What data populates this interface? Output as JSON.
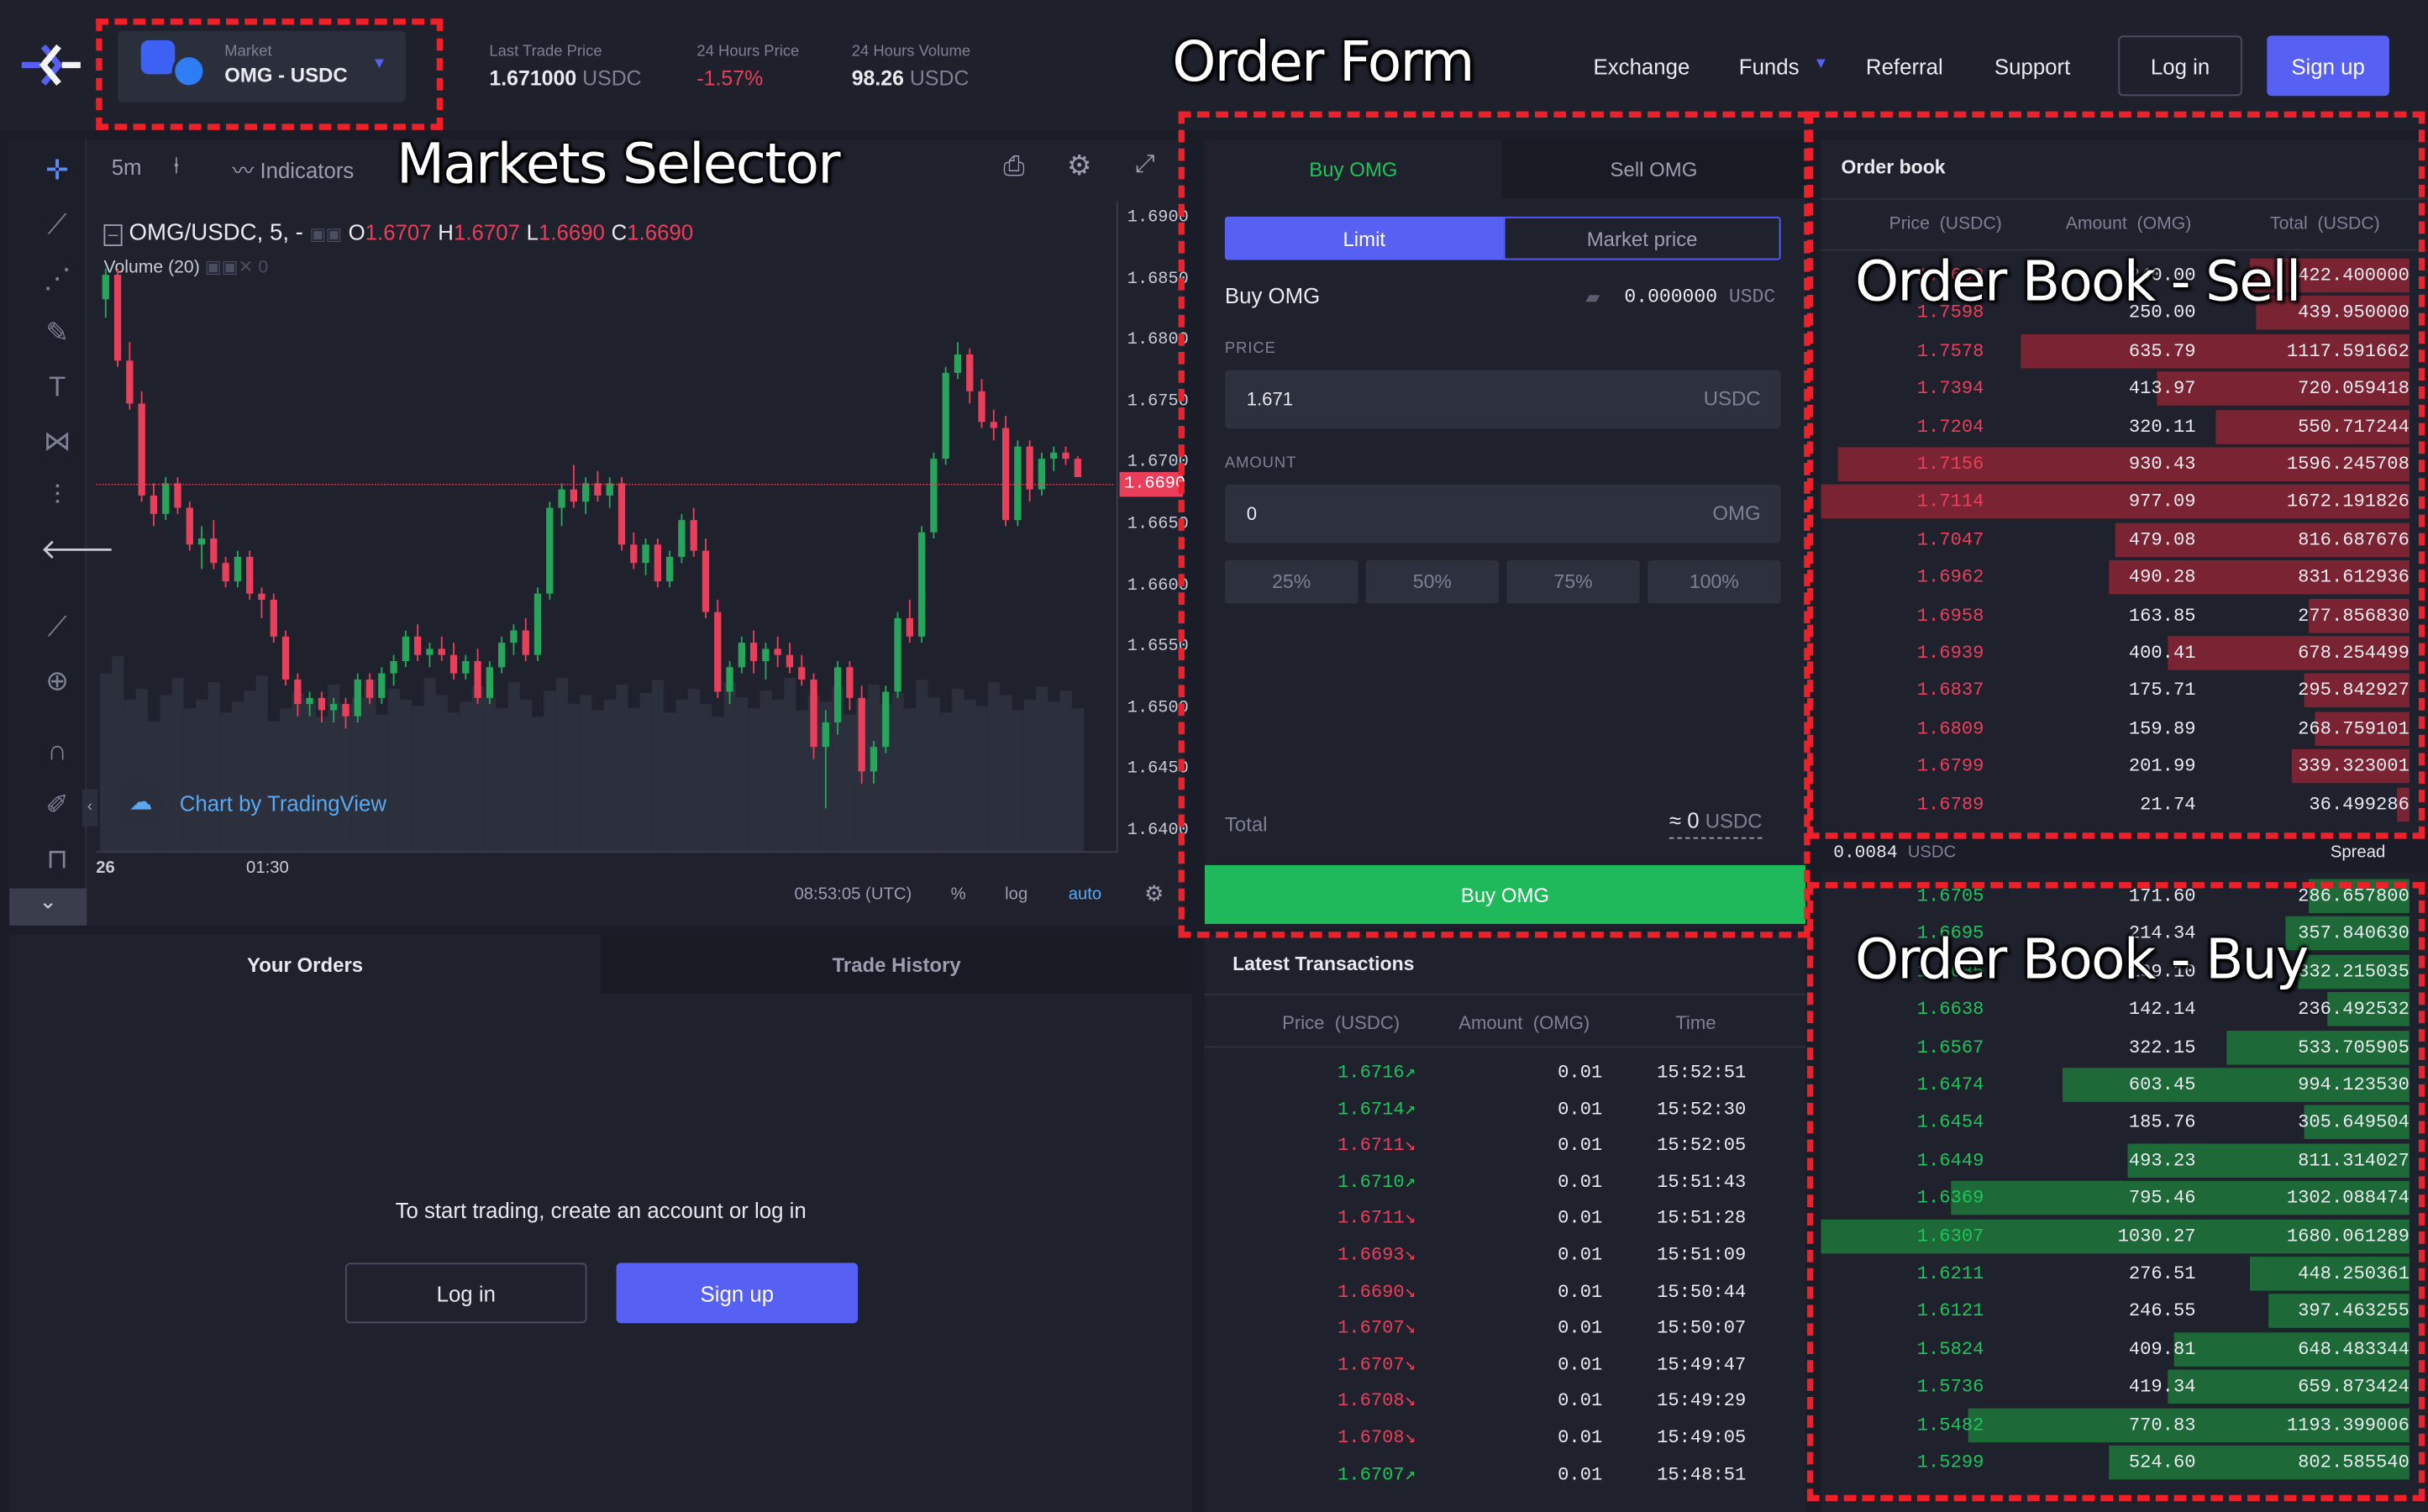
{
  "header": {
    "market_label": "Market",
    "market_value": "OMG - USDC",
    "stats": [
      {
        "label": "Last Trade Price",
        "value": "1.671000",
        "unit": "USDC"
      },
      {
        "label": "24 Hours Price",
        "value": "-1.57%",
        "unit": ""
      },
      {
        "label": "24 Hours Volume",
        "value": "98.26",
        "unit": "USDC"
      }
    ],
    "nav": [
      "Exchange",
      "Funds",
      "Referral",
      "Support"
    ],
    "login": "Log in",
    "signup": "Sign up"
  },
  "annotations": {
    "order_form": "Order Form",
    "markets_selector": "Markets Selector",
    "book_sell": "Order Book - Sell",
    "book_buy": "Order Book - Buy"
  },
  "chart": {
    "interval": "5m",
    "indicators": "Indicators",
    "symbol": "OMG/USDC, 5, -",
    "ohlc": [
      {
        "k": "O",
        "v": "1.6707"
      },
      {
        "k": "H",
        "v": "1.6707"
      },
      {
        "k": "L",
        "v": "1.6690"
      },
      {
        "k": "C",
        "v": "1.6690"
      }
    ],
    "volume_label": "Volume (20)",
    "volume_value": "0",
    "watermark": "Chart by TradingView",
    "x_ticks": [
      "26",
      "01:30"
    ],
    "time": "08:53:05 (UTC)",
    "pct": "%",
    "log": "log",
    "auto": "auto",
    "current_price": "1.6690",
    "colors": {
      "up": "#26a65b",
      "down": "#ea3f5b",
      "bg": "#1f212d"
    }
  },
  "chart_data": {
    "type": "candlestick",
    "y_ticks": [
      "1.6900",
      "1.6850",
      "1.6800",
      "1.6750",
      "1.6700",
      "1.6650",
      "1.6600",
      "1.6550",
      "1.6500",
      "1.6450",
      "1.6400"
    ],
    "ylim": [
      1.6385,
      1.6915
    ],
    "candles": [
      [
        1.6835,
        1.686,
        1.682,
        1.6855
      ],
      [
        1.6855,
        1.686,
        1.678,
        1.6785
      ],
      [
        1.6785,
        1.68,
        1.6745,
        1.675
      ],
      [
        1.675,
        1.676,
        1.667,
        1.6675
      ],
      [
        1.6675,
        1.6685,
        1.665,
        1.666
      ],
      [
        1.666,
        1.669,
        1.6655,
        1.6685
      ],
      [
        1.6685,
        1.669,
        1.666,
        1.6665
      ],
      [
        1.6665,
        1.667,
        1.663,
        1.6635
      ],
      [
        1.6635,
        1.665,
        1.6615,
        1.664
      ],
      [
        1.664,
        1.6655,
        1.6615,
        1.662
      ],
      [
        1.662,
        1.6625,
        1.66,
        1.6605
      ],
      [
        1.6605,
        1.663,
        1.66,
        1.6625
      ],
      [
        1.6625,
        1.663,
        1.659,
        1.6595
      ],
      [
        1.6595,
        1.66,
        1.6575,
        1.659
      ],
      [
        1.659,
        1.6595,
        1.6555,
        1.656
      ],
      [
        1.656,
        1.6565,
        1.652,
        1.6525
      ],
      [
        1.6525,
        1.653,
        1.6495,
        1.6505
      ],
      [
        1.6505,
        1.6515,
        1.6495,
        1.651
      ],
      [
        1.651,
        1.6515,
        1.649,
        1.65
      ],
      [
        1.65,
        1.651,
        1.649,
        1.6505
      ],
      [
        1.6505,
        1.651,
        1.6485,
        1.6495
      ],
      [
        1.6495,
        1.653,
        1.649,
        1.6525
      ],
      [
        1.6525,
        1.653,
        1.6505,
        1.651
      ],
      [
        1.651,
        1.6535,
        1.6505,
        1.653
      ],
      [
        1.653,
        1.6545,
        1.652,
        1.654
      ],
      [
        1.654,
        1.6565,
        1.6535,
        1.656
      ],
      [
        1.656,
        1.657,
        1.654,
        1.6545
      ],
      [
        1.6545,
        1.6555,
        1.6535,
        1.655
      ],
      [
        1.655,
        1.656,
        1.654,
        1.6545
      ],
      [
        1.6545,
        1.6555,
        1.6525,
        1.653
      ],
      [
        1.653,
        1.6545,
        1.6525,
        1.654
      ],
      [
        1.654,
        1.655,
        1.6505,
        1.651
      ],
      [
        1.651,
        1.654,
        1.6505,
        1.6535
      ],
      [
        1.6535,
        1.656,
        1.653,
        1.6555
      ],
      [
        1.6555,
        1.657,
        1.6545,
        1.6565
      ],
      [
        1.6565,
        1.6575,
        1.654,
        1.6545
      ],
      [
        1.6545,
        1.66,
        1.654,
        1.6595
      ],
      [
        1.6595,
        1.667,
        1.659,
        1.6665
      ],
      [
        1.6665,
        1.6685,
        1.665,
        1.668
      ],
      [
        1.668,
        1.67,
        1.6665,
        1.667
      ],
      [
        1.667,
        1.669,
        1.666,
        1.6685
      ],
      [
        1.6685,
        1.6695,
        1.667,
        1.6675
      ],
      [
        1.6675,
        1.669,
        1.6665,
        1.6685
      ],
      [
        1.6685,
        1.669,
        1.663,
        1.6635
      ],
      [
        1.6635,
        1.6645,
        1.6615,
        1.662
      ],
      [
        1.662,
        1.664,
        1.661,
        1.6635
      ],
      [
        1.6635,
        1.664,
        1.66,
        1.6605
      ],
      [
        1.6605,
        1.663,
        1.66,
        1.6625
      ],
      [
        1.6625,
        1.666,
        1.662,
        1.6655
      ],
      [
        1.6655,
        1.6665,
        1.6625,
        1.663
      ],
      [
        1.663,
        1.664,
        1.6575,
        1.658
      ],
      [
        1.658,
        1.659,
        1.651,
        1.6515
      ],
      [
        1.6515,
        1.654,
        1.6505,
        1.6535
      ],
      [
        1.6535,
        1.656,
        1.653,
        1.6555
      ],
      [
        1.6555,
        1.6565,
        1.653,
        1.654
      ],
      [
        1.654,
        1.6555,
        1.6525,
        1.655
      ],
      [
        1.655,
        1.656,
        1.6535,
        1.6545
      ],
      [
        1.6545,
        1.6555,
        1.653,
        1.6535
      ],
      [
        1.6535,
        1.6545,
        1.652,
        1.6525
      ],
      [
        1.6525,
        1.653,
        1.646,
        1.647
      ],
      [
        1.647,
        1.65,
        1.642,
        1.649
      ],
      [
        1.649,
        1.654,
        1.648,
        1.6535
      ],
      [
        1.6535,
        1.654,
        1.65,
        1.651
      ],
      [
        1.651,
        1.652,
        1.644,
        1.645
      ],
      [
        1.645,
        1.6475,
        1.644,
        1.647
      ],
      [
        1.647,
        1.652,
        1.6465,
        1.6515
      ],
      [
        1.6515,
        1.658,
        1.651,
        1.6575
      ],
      [
        1.6575,
        1.659,
        1.6555,
        1.656
      ],
      [
        1.656,
        1.665,
        1.6555,
        1.6645
      ],
      [
        1.6645,
        1.671,
        1.664,
        1.6705
      ],
      [
        1.6705,
        1.678,
        1.67,
        1.6775
      ],
      [
        1.6775,
        1.68,
        1.677,
        1.679
      ],
      [
        1.679,
        1.6795,
        1.675,
        1.676
      ],
      [
        1.676,
        1.677,
        1.673,
        1.6735
      ],
      [
        1.6735,
        1.6745,
        1.672,
        1.673
      ],
      [
        1.673,
        1.674,
        1.665,
        1.6655
      ],
      [
        1.6655,
        1.672,
        1.665,
        1.6715
      ],
      [
        1.6715,
        1.672,
        1.667,
        1.668
      ],
      [
        1.668,
        1.671,
        1.6675,
        1.6705
      ],
      [
        1.6705,
        1.6715,
        1.6695,
        1.671
      ],
      [
        1.671,
        1.6715,
        1.67,
        1.6705
      ],
      [
        1.6705,
        1.6707,
        1.669,
        1.669
      ]
    ],
    "volumes": [
      0.82,
      0.9,
      0.7,
      0.75,
      0.6,
      0.72,
      0.8,
      0.66,
      0.7,
      0.78,
      0.64,
      0.69,
      0.74,
      0.81,
      0.6,
      0.66,
      0.73,
      0.7,
      0.62,
      0.77,
      0.68,
      0.71,
      0.79,
      0.63,
      0.75,
      0.7,
      0.67,
      0.8,
      0.72,
      0.64,
      0.69,
      0.76,
      0.71,
      0.66,
      0.78,
      0.7,
      0.62,
      0.74,
      0.8,
      0.68,
      0.72,
      0.65,
      0.7,
      0.77,
      0.66,
      0.73,
      0.79,
      0.64,
      0.7,
      0.75,
      0.68,
      0.62,
      0.78,
      0.71,
      0.66,
      0.74,
      0.7,
      0.8,
      0.65,
      0.72,
      0.69,
      0.76,
      0.63,
      0.7,
      0.77,
      0.68,
      0.73,
      0.66,
      0.79,
      0.71,
      0.64,
      0.75,
      0.7,
      0.67,
      0.78,
      0.72,
      0.65,
      0.7,
      0.76,
      0.69,
      0.74,
      0.66
    ]
  },
  "order_form": {
    "tab_buy": "Buy OMG",
    "tab_sell": "Sell OMG",
    "type_limit": "Limit",
    "type_market": "Market price",
    "side_label": "Buy OMG",
    "balance": "0.000000",
    "balance_unit": "USDC",
    "price_label": "PRICE",
    "price_value": "1.671",
    "price_unit": "USDC",
    "amount_label": "AMOUNT",
    "amount_value": "0",
    "amount_unit": "OMG",
    "pcts": [
      "25%",
      "50%",
      "75%",
      "100%"
    ],
    "total_label": "Total",
    "total_value": "≈ 0",
    "total_unit": "USDC",
    "submit": "Buy OMG",
    "colors": {
      "accent": "#5660f2",
      "buy": "#1fb85a"
    }
  },
  "orders": {
    "tab_orders": "Your Orders",
    "tab_history": "Trade History",
    "message": "To start trading, create an account or log in",
    "login": "Log in",
    "signup": "Sign up"
  },
  "latest": {
    "title": "Latest Transactions",
    "headers": [
      "Price  (USDC)",
      "Amount  (OMG)",
      "Time"
    ],
    "rows": [
      {
        "price": "1.6716",
        "dir": "up",
        "amount": "0.01",
        "time": "15:52:51"
      },
      {
        "price": "1.6714",
        "dir": "up",
        "amount": "0.01",
        "time": "15:52:30"
      },
      {
        "price": "1.6711",
        "dir": "down",
        "amount": "0.01",
        "time": "15:52:05"
      },
      {
        "price": "1.6710",
        "dir": "up",
        "amount": "0.01",
        "time": "15:51:43"
      },
      {
        "price": "1.6711",
        "dir": "down",
        "amount": "0.01",
        "time": "15:51:28"
      },
      {
        "price": "1.6693",
        "dir": "down",
        "amount": "0.01",
        "time": "15:51:09"
      },
      {
        "price": "1.6690",
        "dir": "down",
        "amount": "0.01",
        "time": "15:50:44"
      },
      {
        "price": "1.6707",
        "dir": "down",
        "amount": "0.01",
        "time": "15:50:07"
      },
      {
        "price": "1.6707",
        "dir": "down",
        "amount": "0.01",
        "time": "15:49:47"
      },
      {
        "price": "1.6708",
        "dir": "down",
        "amount": "0.01",
        "time": "15:49:29"
      },
      {
        "price": "1.6708",
        "dir": "down",
        "amount": "0.01",
        "time": "15:49:05"
      },
      {
        "price": "1.6707",
        "dir": "up",
        "amount": "0.01",
        "time": "15:48:51"
      }
    ]
  },
  "orderbook": {
    "title": "Order book",
    "headers": [
      "Price  (USDC)",
      "Amount  (OMG)",
      "Total  (USDC)"
    ],
    "asks": [
      {
        "price": "1.7600",
        "amount": "240.00",
        "total": "422.400000",
        "depth": 0.27
      },
      {
        "price": "1.7598",
        "amount": "250.00",
        "total": "439.950000",
        "depth": 0.26
      },
      {
        "price": "1.7578",
        "amount": "635.79",
        "total": "1117.591662",
        "depth": 0.66
      },
      {
        "price": "1.7394",
        "amount": "413.97",
        "total": "720.059418",
        "depth": 0.43
      },
      {
        "price": "1.7204",
        "amount": "320.11",
        "total": "550.717244",
        "depth": 0.33
      },
      {
        "price": "1.7156",
        "amount": "930.43",
        "total": "1596.245708",
        "depth": 0.97
      },
      {
        "price": "1.7114",
        "amount": "977.09",
        "total": "1672.191826",
        "depth": 1.0
      },
      {
        "price": "1.7047",
        "amount": "479.08",
        "total": "816.687676",
        "depth": 0.5
      },
      {
        "price": "1.6962",
        "amount": "490.28",
        "total": "831.612936",
        "depth": 0.51
      },
      {
        "price": "1.6958",
        "amount": "163.85",
        "total": "277.856830",
        "depth": 0.17
      },
      {
        "price": "1.6939",
        "amount": "400.41",
        "total": "678.254499",
        "depth": 0.41
      },
      {
        "price": "1.6837",
        "amount": "175.71",
        "total": "295.842927",
        "depth": 0.18
      },
      {
        "price": "1.6809",
        "amount": "159.89",
        "total": "268.759101",
        "depth": 0.16
      },
      {
        "price": "1.6799",
        "amount": "201.99",
        "total": "339.323001",
        "depth": 0.2
      },
      {
        "price": "1.6789",
        "amount": "21.74",
        "total": "36.499286",
        "depth": 0.02
      }
    ],
    "spread_value": "0.0084",
    "spread_unit": "USDC",
    "spread_label": "Spread",
    "bids": [
      {
        "price": "1.6705",
        "amount": "171.60",
        "total": "286.657800",
        "depth": 0.17
      },
      {
        "price": "1.6695",
        "amount": "214.34",
        "total": "357.840630",
        "depth": 0.21
      },
      {
        "price": "1.6685",
        "amount": "199.10",
        "total": "332.215035",
        "depth": 0.19
      },
      {
        "price": "1.6638",
        "amount": "142.14",
        "total": "236.492532",
        "depth": 0.14
      },
      {
        "price": "1.6567",
        "amount": "322.15",
        "total": "533.705905",
        "depth": 0.31
      },
      {
        "price": "1.6474",
        "amount": "603.45",
        "total": "994.123530",
        "depth": 0.59
      },
      {
        "price": "1.6454",
        "amount": "185.76",
        "total": "305.649504",
        "depth": 0.18
      },
      {
        "price": "1.6449",
        "amount": "493.23",
        "total": "811.314027",
        "depth": 0.48
      },
      {
        "price": "1.6369",
        "amount": "795.46",
        "total": "1302.088474",
        "depth": 0.78
      },
      {
        "price": "1.6307",
        "amount": "1030.27",
        "total": "1680.061289",
        "depth": 1.0
      },
      {
        "price": "1.6211",
        "amount": "276.51",
        "total": "448.250361",
        "depth": 0.27
      },
      {
        "price": "1.6121",
        "amount": "246.55",
        "total": "397.463255",
        "depth": 0.24
      },
      {
        "price": "1.5824",
        "amount": "409.81",
        "total": "648.483344",
        "depth": 0.4
      },
      {
        "price": "1.5736",
        "amount": "419.34",
        "total": "659.873424",
        "depth": 0.41
      },
      {
        "price": "1.5482",
        "amount": "770.83",
        "total": "1193.399006",
        "depth": 0.75
      },
      {
        "price": "1.5299",
        "amount": "524.60",
        "total": "802.585540",
        "depth": 0.51
      }
    ],
    "colors": {
      "ask_bar": "#7a2433",
      "bid_bar": "#1d6a38",
      "ask_text": "#ea3f5b",
      "bid_text": "#1fc45a"
    }
  }
}
